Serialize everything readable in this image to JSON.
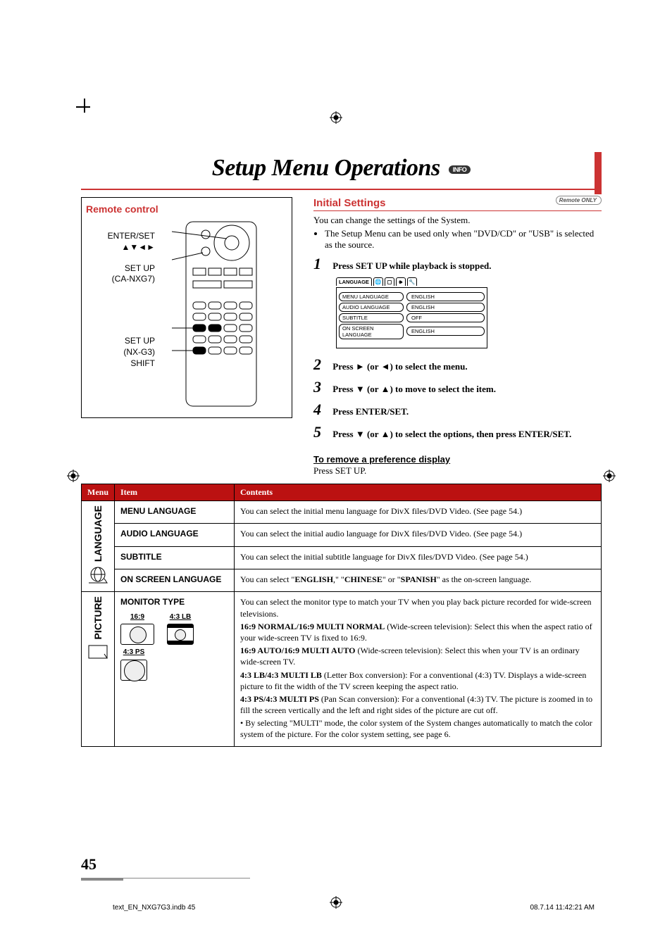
{
  "title": "Setup Menu Operations",
  "info_badge": "INFO",
  "remote": {
    "box_title": "Remote control",
    "labels": {
      "enter_set": "ENTER/SET",
      "arrows": "▲▼◄►",
      "setup1": "SET UP",
      "setup1_sub": "(CA-NXG7)",
      "setup2": "SET UP",
      "setup2_sub": "(NX-G3)",
      "shift": "SHIFT"
    }
  },
  "initial": {
    "heading": "Initial Settings",
    "remote_badge": "Remote ONLY",
    "intro": "You can change the settings of the System.",
    "bullet": "The Setup Menu can be used only when \"DVD/CD\" or \"USB\" is selected as the source.",
    "steps": {
      "s1": "Press SET UP while playback is stopped.",
      "s2": "Press ► (or ◄) to select the menu.",
      "s3": "Press ▼ (or ▲) to move to select the item.",
      "s4": "Press ENTER/SET.",
      "s5": "Press ▼ (or ▲) to select the options, then press ENTER/SET."
    },
    "screen": {
      "tab": "LANGUAGE",
      "rows": [
        {
          "k": "MENU LANGUAGE",
          "v": "ENGLISH"
        },
        {
          "k": "AUDIO LANGUAGE",
          "v": "ENGLISH"
        },
        {
          "k": "SUBTITLE",
          "v": "OFF"
        },
        {
          "k": "ON SCREEN LANGUAGE",
          "v": "ENGLISH"
        }
      ]
    },
    "remove_h": "To remove a preference display",
    "remove_t": "Press SET UP."
  },
  "table": {
    "headers": {
      "menu": "Menu",
      "item": "Item",
      "contents": "Contents"
    },
    "language": {
      "side": "LANGUAGE",
      "rows": [
        {
          "item": "MENU LANGUAGE",
          "content": "You can select the initial menu language for DivX files/DVD Video. (See page 54.)"
        },
        {
          "item": "AUDIO LANGUAGE",
          "content": "You can select the initial audio language for DivX files/DVD Video. (See page 54.)"
        },
        {
          "item": "SUBTITLE",
          "content": "You can select the initial subtitle language for DivX files/DVD Video. (See page 54.)"
        },
        {
          "item": "ON SCREEN LANGUAGE",
          "content_pre": "You can select \"",
          "b1": "ENGLISH",
          "mid1": ",\" \"",
          "b2": "CHINESE",
          "mid2": "\"  or \"",
          "b3": "SPANISH",
          "content_post": "\" as the on-screen language."
        }
      ]
    },
    "picture": {
      "side": "PICTURE",
      "item": "MONITOR TYPE",
      "mi": {
        "m1": "16:9",
        "m2": "4:3 LB",
        "m3": "4:3 PS"
      },
      "content_lines": [
        "You can select the monitor type to match your TV when you play back picture recorded for wide-screen televisions.",
        "<b>16:9 NORMAL/16:9 MULTI NORMAL</b> (Wide-screen television): Select this when the aspect ratio of your wide-screen TV is fixed to 16:9.",
        "<b>16:9 AUTO/16:9 MULTI AUTO</b> (Wide-screen television): Select this when your TV is an ordinary wide-screen TV.",
        "<b>4:3 LB/4:3 MULTI LB</b> (Letter Box conversion): For a conventional (4:3) TV. Displays a wide-screen picture to fit the width of the TV screen keeping the aspect ratio.",
        "<b>4:3 PS/4:3 MULTI PS</b> (Pan Scan conversion): For a conventional (4:3) TV. The picture is zoomed in to fill the screen vertically and the left and right sides of the picture are cut off.",
        "• By selecting \"MULTI\" mode, the color system of the System changes automatically to match the color system of the picture. For the color system setting, see page 6."
      ]
    }
  },
  "page_number": "45",
  "footer": {
    "left": "text_EN_NXG7G3.indb   45",
    "right": "08.7.14   11:42:21 AM"
  }
}
